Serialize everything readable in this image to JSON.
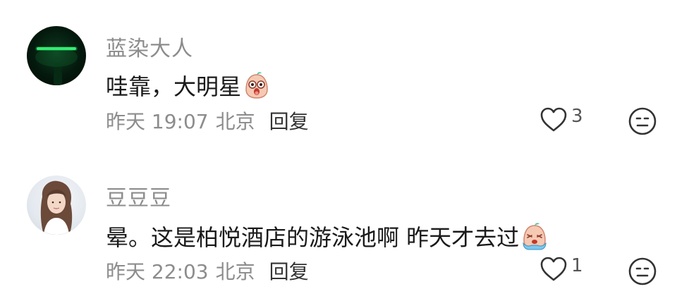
{
  "comments": [
    {
      "username": "蓝染大人",
      "text": "哇靠，大明星",
      "emoji": "surprised-face-emoji",
      "time": "昨天 19:07",
      "location": "北京",
      "reply_label": "回复",
      "likes": "3",
      "avatar": "green-neon-silhouette-avatar"
    },
    {
      "username": "豆豆豆",
      "text": "晕。这是柏悦酒店的游泳池啊 昨天才去过",
      "emoji": "crying-face-emoji",
      "time": "昨天 22:03",
      "location": "北京",
      "reply_label": "回复",
      "likes": "1",
      "avatar": "girl-portrait-avatar"
    }
  ],
  "icons": {
    "like": "heart-outline-icon",
    "reaction": "emoji-face-icon"
  },
  "colors": {
    "username": "#8c8c8c",
    "text": "#1a1a1a",
    "meta": "#8c8c8c",
    "reply": "#333333",
    "icon": "#333333"
  }
}
